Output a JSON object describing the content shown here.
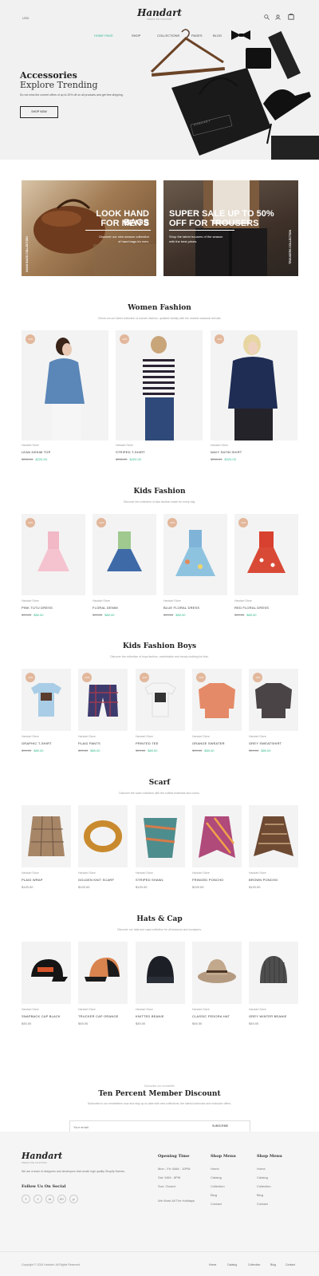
{
  "header": {
    "currency": "USD",
    "logo": "Handart",
    "logo_tagline": "CREATIVE FASHION",
    "nav": [
      "HOME PAGE",
      "SHOP",
      "COLLECTIONS",
      "PAGES",
      "BLOG"
    ],
    "active_nav": 0
  },
  "hero": {
    "title_line1": "Accessories",
    "title_line2": "Explore Trending",
    "description": "Do not miss the current offers of up to 20% off on all products and get free shipping.",
    "button": "SHOP NOW",
    "bag_label": "HANDART"
  },
  "banners": [
    {
      "title_line1": "LOOK HAND BAGS",
      "title_line2": "FOR MEN'S",
      "desc_line1": "Discover our new season collection",
      "desc_line2": "of hand bags for men.",
      "side": "HAND BAGS COLLECTION"
    },
    {
      "title_line1": "SUPER SALE UP TO 50%",
      "title_line2": "OFF FOR TROUSERS",
      "desc_line1": "Shop the latest trousers of the season",
      "desc_line2": "with the best prices.",
      "side": "TROUSERS COLLECTION"
    }
  ],
  "sections": {
    "women": {
      "title": "Women Fashion",
      "subtitle": "Check out our latest collection of women fashion, updated weekly with the newest seasonal arrivals.",
      "products": [
        {
          "badge": "-10%",
          "category": "Handart Store",
          "name": "LEAN DENIM TOP",
          "old": "$250.00",
          "new": "$220.00"
        },
        {
          "badge": "-10%",
          "category": "Handart Store",
          "name": "STRIPED T-SHIRT",
          "old": "$250.00",
          "new": "$220.00"
        },
        {
          "badge": "-10%",
          "category": "Handart Store",
          "name": "NAVY SATIN SHIRT",
          "old": "$250.00",
          "new": "$220.00"
        }
      ]
    },
    "kids": {
      "title": "Kids Fashion",
      "subtitle": "Discover the collection of kids fashion made for every day.",
      "products": [
        {
          "badge": "-10%",
          "category": "Handart Store",
          "name": "PINK TUTU DRESS",
          "old": "$99.00",
          "new": "$89.00"
        },
        {
          "badge": "-10%",
          "category": "Handart Store",
          "name": "FLORAL DENIM",
          "old": "$99.00",
          "new": "$89.00"
        },
        {
          "badge": "-10%",
          "category": "Handart Store",
          "name": "BLUE FLORAL DRESS",
          "old": "$99.00",
          "new": "$89.00"
        },
        {
          "badge": "-10%",
          "category": "Handart Store",
          "name": "RED FLORAL DRESS",
          "old": "$99.00",
          "new": "$89.00"
        }
      ]
    },
    "boys": {
      "title": "Kids Fashion Boys",
      "subtitle": "Discover the collection of boys fashion, comfortable and trendy clothing for kids.",
      "products": [
        {
          "badge": "-10%",
          "category": "Handart Store",
          "name": "GRAPHIC T-SHIRT",
          "old": "$99.00",
          "new": "$89.00"
        },
        {
          "badge": "-10%",
          "category": "Handart Store",
          "name": "PLAID PANTS",
          "old": "$99.00",
          "new": "$89.00"
        },
        {
          "badge": "-10%",
          "category": "Handart Store",
          "name": "PRINTED TEE",
          "old": "$99.00",
          "new": "$89.00"
        },
        {
          "badge": "-10%",
          "category": "Handart Store",
          "name": "ORANGE SWEATER",
          "old": "$99.00",
          "new": "$89.00"
        },
        {
          "badge": "-10%",
          "category": "Handart Store",
          "name": "GREY SWEATSHIRT",
          "old": "$99.00",
          "new": "$89.00"
        }
      ]
    },
    "scarf": {
      "title": "Scarf",
      "subtitle": "Discover the scarf collection with the softest materials and colors.",
      "products": [
        {
          "category": "Handart Store",
          "name": "PLAID WRAP",
          "price": "$120.00"
        },
        {
          "category": "Handart Store",
          "name": "GOLDEN KNIT SCARF",
          "price": "$120.00"
        },
        {
          "category": "Handart Store",
          "name": "STRIPED SHAWL",
          "price": "$120.00"
        },
        {
          "category": "Handart Store",
          "name": "FRINGED PONCHO",
          "price": "$120.00"
        },
        {
          "category": "Handart Store",
          "name": "BROWN PONCHO",
          "price": "$120.00"
        }
      ]
    },
    "hats": {
      "title": "Hats & Cap",
      "subtitle": "Discover our hats and caps collection for all seasons and occasions.",
      "products": [
        {
          "category": "Handart Store",
          "name": "SNAPBACK CAP BLACK",
          "price": "$45.00"
        },
        {
          "category": "Handart Store",
          "name": "TRUCKER CAP ORANGE",
          "price": "$45.00"
        },
        {
          "category": "Handart Store",
          "name": "KNITTED BEANIE",
          "price": "$45.00"
        },
        {
          "category": "Handart Store",
          "name": "CLASSIC FEDORA HAT",
          "price": "$45.00"
        },
        {
          "category": "Handart Store",
          "name": "GREY WINTER BEANIE",
          "price": "$45.00"
        }
      ]
    }
  },
  "newsletter": {
    "kicker": "Subscribe our newsletter",
    "title": "Ten Percent Member Discount",
    "description": "Subscribe to our newsletters now and stay up-to-date with new collections, the latest lookbooks and exclusive offers.",
    "placeholder": "Your email",
    "button": "SUBSCRIBE"
  },
  "footer": {
    "about": "We are a team of designers and developers that create high quality Shopify themes.",
    "follow": "Follow Us On Social",
    "social": [
      "f",
      "t",
      "in",
      "G+",
      "p"
    ],
    "col1": {
      "title": "Opening Time",
      "items": [
        "Mon - Fri: 8AM - 10PM",
        "Sat: 9AM - 8PM",
        "Sun: Closed",
        "We Work All The Holidays"
      ]
    },
    "col2": {
      "title": "Shop Menu",
      "items": [
        "Home",
        "Catalog",
        "Collection",
        "Blog",
        "Contact"
      ]
    },
    "col3": {
      "title": "Shop Menu",
      "items": [
        "Home",
        "Catalog",
        "Collection",
        "Blog",
        "Contact"
      ]
    },
    "copyright": "Copyright © 2024 Handart. All Rights Reserved.",
    "links": [
      "Home",
      "Catalog",
      "Collection",
      "Blog",
      "Contact"
    ]
  },
  "colors": {
    "accent": "#2eb88e",
    "badge": "#e2b79b",
    "hero_bg": "#f1f1f2"
  }
}
